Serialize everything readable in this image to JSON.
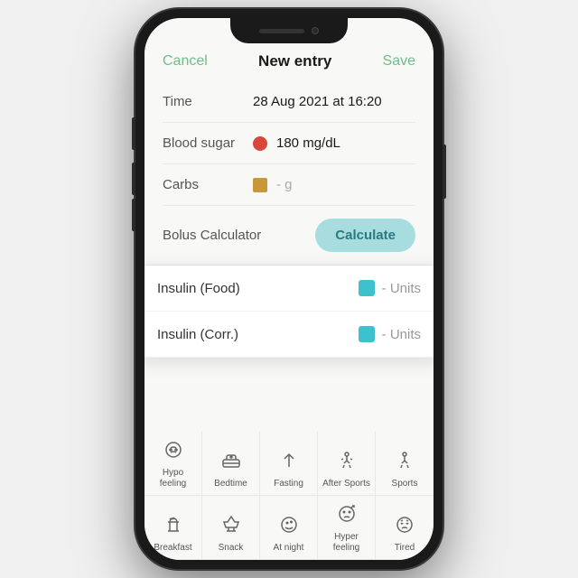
{
  "header": {
    "cancel_label": "Cancel",
    "title": "New entry",
    "save_label": "Save"
  },
  "form": {
    "time_label": "Time",
    "time_value": "28 Aug 2021 at 16:20",
    "blood_sugar_label": "Blood sugar",
    "blood_sugar_value": "180 mg/dL",
    "carbs_label": "Carbs",
    "carbs_value": "- g"
  },
  "bolus": {
    "label": "Bolus Calculator",
    "button_label": "Calculate"
  },
  "insulin": [
    {
      "label": "Insulin (Food)",
      "value": "- Units"
    },
    {
      "label": "Insulin (Corr.)",
      "value": "- Units"
    }
  ],
  "tags": {
    "row1": [
      {
        "icon": "🫀",
        "label": "Hypo feeling"
      },
      {
        "icon": "🛏",
        "label": "Bedtime"
      },
      {
        "icon": "⬆",
        "label": "Fasting"
      },
      {
        "icon": "🏃",
        "label": "After Sports"
      },
      {
        "icon": "⚽",
        "label": "Sports"
      }
    ],
    "row2": [
      {
        "icon": "☕",
        "label": "Breakfast"
      },
      {
        "icon": "🍕",
        "label": "Snack"
      },
      {
        "icon": "🌙",
        "label": "At night"
      },
      {
        "icon": "😵",
        "label": "Hyper feeling"
      },
      {
        "icon": "😴",
        "label": "Tired"
      }
    ]
  }
}
